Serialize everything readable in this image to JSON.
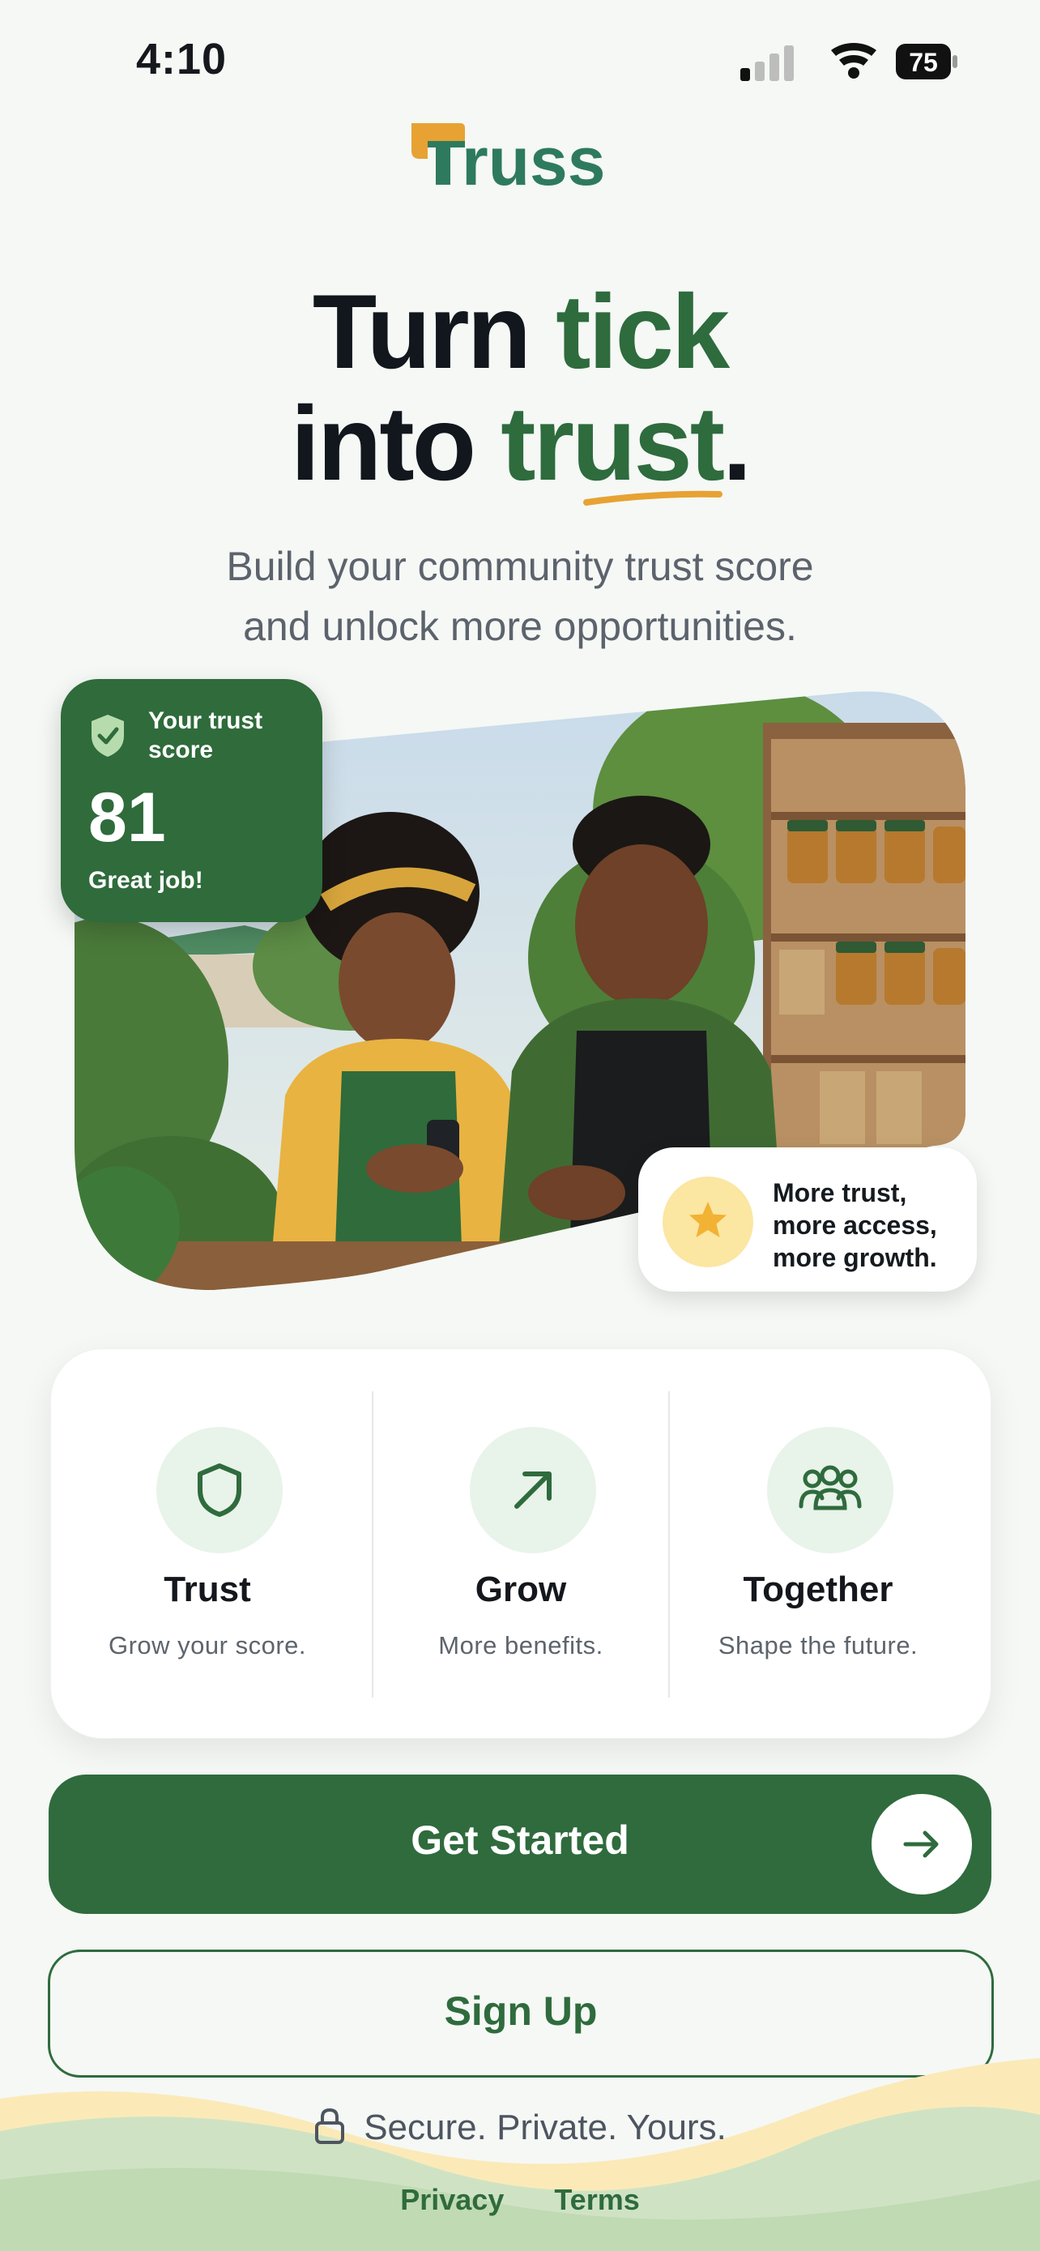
{
  "status_bar": {
    "time": "4:10",
    "battery": "75"
  },
  "brand": {
    "name": "Truss",
    "logo_text": "russ",
    "primary_color": "#2f6b3d",
    "accent_color": "#e7a233"
  },
  "headline": {
    "word1": "Turn",
    "word2": "tick",
    "word3": "into",
    "word4": "trust",
    "period": "."
  },
  "subtitle": {
    "line1": "Build your community trust score",
    "line2": "and unlock more opportunities."
  },
  "trust_card": {
    "label": "Your trust score",
    "score": "81",
    "caption": "Great job!",
    "icon": "shield-check-icon"
  },
  "benefit": {
    "line1": "More trust,",
    "line2": "more access,",
    "line3": "more growth.",
    "icon": "star-icon"
  },
  "features": [
    {
      "title": "Trust",
      "description": "Grow your score.",
      "icon": "shield-icon"
    },
    {
      "title": "Grow",
      "description": "More benefits.",
      "icon": "arrow-up-right-icon"
    },
    {
      "title": "Together",
      "description": "Shape the future.",
      "icon": "people-group-icon"
    }
  ],
  "actions": {
    "primary": "Get Started",
    "secondary": "Sign Up"
  },
  "footer": {
    "secure_text": "Secure. Private. Yours.",
    "privacy": "Privacy",
    "terms": "Terms"
  }
}
